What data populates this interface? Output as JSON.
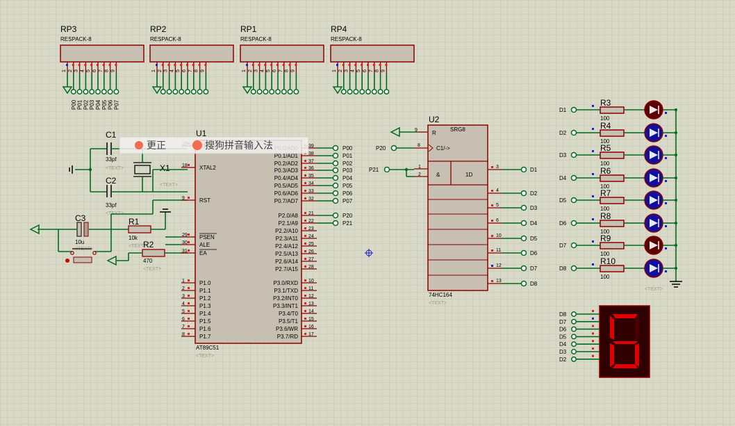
{
  "ime_bar": {
    "label1": "更正",
    "label2": "搜狗拼音输入法"
  },
  "text_placeholder": "<TEXT>",
  "respacks": [
    {
      "ref": "RP3",
      "part": "RESPACK-8",
      "pins": [
        "1",
        "2",
        "3",
        "4",
        "5",
        "6",
        "7",
        "8",
        "9"
      ],
      "nets": [
        "P00",
        "P01",
        "P02",
        "P03",
        "P04",
        "P05",
        "P06",
        "P07"
      ]
    },
    {
      "ref": "RP2",
      "part": "RESPACK-8",
      "pins": [
        "1",
        "2",
        "3",
        "4",
        "5",
        "6",
        "7",
        "8",
        "9"
      ],
      "nets": []
    },
    {
      "ref": "RP1",
      "part": "RESPACK-8",
      "pins": [
        "1",
        "2",
        "3",
        "4",
        "5",
        "6",
        "7",
        "8",
        "9"
      ],
      "nets": []
    },
    {
      "ref": "RP4",
      "part": "RESPACK-8",
      "pins": [
        "1",
        "2",
        "3",
        "4",
        "5",
        "6",
        "7",
        "8",
        "9"
      ],
      "nets": []
    }
  ],
  "u1": {
    "ref": "U1",
    "part": "AT89C51",
    "left_pins": [
      {
        "num": "19",
        "name": "XTAL1"
      },
      {
        "num": "18",
        "name": "XTAL2"
      },
      {
        "num": "9",
        "name": "RST"
      },
      {
        "num": "29",
        "name": "PSEN"
      },
      {
        "num": "30",
        "name": "ALE"
      },
      {
        "num": "31",
        "name": "EA"
      },
      {
        "num": "1",
        "name": "P1.0"
      },
      {
        "num": "2",
        "name": "P1.1"
      },
      {
        "num": "3",
        "name": "P1.2"
      },
      {
        "num": "4",
        "name": "P1.3"
      },
      {
        "num": "5",
        "name": "P1.4"
      },
      {
        "num": "6",
        "name": "P1.5"
      },
      {
        "num": "7",
        "name": "P1.6"
      },
      {
        "num": "8",
        "name": "P1.7"
      }
    ],
    "right_pins": [
      {
        "num": "39",
        "name": "P0.0/AD0",
        "net": "P00"
      },
      {
        "num": "38",
        "name": "P0.1/AD1",
        "net": "P01"
      },
      {
        "num": "37",
        "name": "P0.2/AD2",
        "net": "P02"
      },
      {
        "num": "36",
        "name": "P0.3/AD3",
        "net": "P03"
      },
      {
        "num": "35",
        "name": "P0.4/AD4",
        "net": "P04"
      },
      {
        "num": "34",
        "name": "P0.5/AD5",
        "net": "P05"
      },
      {
        "num": "33",
        "name": "P0.6/AD6",
        "net": "P06"
      },
      {
        "num": "32",
        "name": "P0.7/AD7",
        "net": "P07"
      },
      {
        "num": "21",
        "name": "P2.0/A8",
        "net": "P20"
      },
      {
        "num": "22",
        "name": "P2.1/A9",
        "net": "P21"
      },
      {
        "num": "23",
        "name": "P2.2/A10",
        "net": ""
      },
      {
        "num": "24",
        "name": "P2.3/A11",
        "net": ""
      },
      {
        "num": "25",
        "name": "P2.4/A12",
        "net": ""
      },
      {
        "num": "26",
        "name": "P2.5/A13",
        "net": ""
      },
      {
        "num": "27",
        "name": "P2.6/A14",
        "net": ""
      },
      {
        "num": "28",
        "name": "P2.7/A15",
        "net": ""
      },
      {
        "num": "10",
        "name": "P3.0/RXD",
        "net": ""
      },
      {
        "num": "11",
        "name": "P3.1/TXD",
        "net": ""
      },
      {
        "num": "12",
        "name": "P3.2/INT0",
        "net": ""
      },
      {
        "num": "13",
        "name": "P3.3/INT1",
        "net": ""
      },
      {
        "num": "14",
        "name": "P3.4/T0",
        "net": ""
      },
      {
        "num": "15",
        "name": "P3.5/T1",
        "net": ""
      },
      {
        "num": "16",
        "name": "P3.6/WR",
        "net": ""
      },
      {
        "num": "17",
        "name": "P3.7/RD",
        "net": ""
      }
    ]
  },
  "passives": {
    "c1": {
      "ref": "C1",
      "value": "33pf"
    },
    "c2": {
      "ref": "C2",
      "value": "33pf"
    },
    "c3": {
      "ref": "C3",
      "value": "10u"
    },
    "x1": {
      "ref": "X1"
    },
    "r1": {
      "ref": "R1",
      "value": "10k"
    },
    "r2": {
      "ref": "R2",
      "value": "470"
    }
  },
  "u2": {
    "ref": "U2",
    "part": "74HC164",
    "title": "SRG8",
    "reset_label": "R",
    "clock_label": "C1/->",
    "and_label": "&",
    "data_label": "1D",
    "reset_pin": "9",
    "clock_pin": "8",
    "in_pins": [
      "1",
      "2"
    ],
    "clock_net": "P20",
    "data_net": "P21",
    "outputs": [
      {
        "pin": "3",
        "net": "D1"
      },
      {
        "pin": "4",
        "net": "D2"
      },
      {
        "pin": "5",
        "net": "D3"
      },
      {
        "pin": "6",
        "net": "D4"
      },
      {
        "pin": "10",
        "net": "D5"
      },
      {
        "pin": "11",
        "net": "D6"
      },
      {
        "pin": "12",
        "net": "D7"
      },
      {
        "pin": "13",
        "net": "D8"
      }
    ]
  },
  "led_resistors": [
    {
      "ref": "R3",
      "value": "100",
      "net": "D1",
      "led": "red"
    },
    {
      "ref": "R4",
      "value": "100",
      "net": "D2",
      "led": "blue"
    },
    {
      "ref": "R5",
      "value": "100",
      "net": "D3",
      "led": "blue"
    },
    {
      "ref": "R6",
      "value": "100",
      "net": "D4",
      "led": "blue"
    },
    {
      "ref": "R7",
      "value": "100",
      "net": "D5",
      "led": "blue"
    },
    {
      "ref": "R8",
      "value": "100",
      "net": "D6",
      "led": "blue"
    },
    {
      "ref": "R9",
      "value": "100",
      "net": "D7",
      "led": "red"
    },
    {
      "ref": "R10",
      "value": "100",
      "net": "D8",
      "led": "blue"
    }
  ],
  "seven_seg": {
    "digit": "6",
    "nets": [
      "D8",
      "D7",
      "D6",
      "D5",
      "D4",
      "D3",
      "D2"
    ]
  },
  "colors": {
    "background": "#d9d9c8",
    "wire": "#006b1f",
    "body": "#c7c0b2",
    "outline": "#8b0000",
    "led_red": "#cc0000",
    "led_blue": "#1a1acc",
    "segment_on": "#e00000",
    "display_bg": "#300000"
  }
}
